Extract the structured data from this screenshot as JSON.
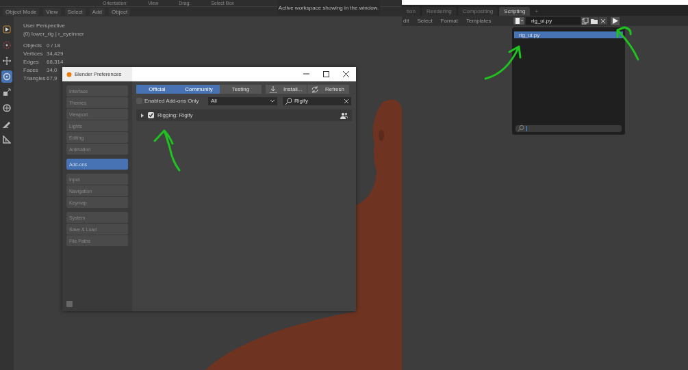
{
  "viewport_header": {
    "items": [
      "Orientation:",
      "View",
      "Drag:",
      "Select Box"
    ]
  },
  "viewport_menu": {
    "mode": "Object Mode",
    "items": [
      "View",
      "Select",
      "Add",
      "Object"
    ]
  },
  "toolbar": {
    "tools": [
      {
        "kind": "select",
        "selected": false
      },
      {
        "kind": "cursor",
        "selected": false
      },
      {
        "kind": "move",
        "selected": false
      },
      {
        "kind": "rotate",
        "selected": true
      },
      {
        "kind": "scale",
        "selected": false
      },
      {
        "kind": "transform",
        "selected": false
      },
      {
        "kind": "annotate",
        "selected": false
      },
      {
        "kind": "measure",
        "selected": false
      }
    ]
  },
  "viewport_info": {
    "view": "User Perspective",
    "object": "(0) lower_rig | r_eyeinner",
    "stats": [
      {
        "label": "Objects",
        "value": "0 / 18"
      },
      {
        "label": "Vertices",
        "value": "34,429"
      },
      {
        "label": "Edges",
        "value": "68,314"
      },
      {
        "label": "Faces",
        "value": "34,0"
      },
      {
        "label": "Triangles",
        "value": "67,9"
      }
    ]
  },
  "tooltip": "Active workspace showing in the window.",
  "preferences": {
    "title": "Blender Preferences",
    "sidebar": {
      "groups": [
        {
          "items": [
            {
              "label": "Interface",
              "selected": false
            },
            {
              "label": "Themes",
              "selected": false
            },
            {
              "label": "Viewport",
              "selected": false
            },
            {
              "label": "Lights",
              "selected": false
            },
            {
              "label": "Editing",
              "selected": false
            },
            {
              "label": "Animation",
              "selected": false
            }
          ]
        },
        {
          "items": [
            {
              "label": "Add-ons",
              "selected": true
            }
          ]
        },
        {
          "items": [
            {
              "label": "Input",
              "selected": false
            },
            {
              "label": "Navigation",
              "selected": false
            },
            {
              "label": "Keymap",
              "selected": false
            }
          ]
        },
        {
          "items": [
            {
              "label": "System",
              "selected": false
            },
            {
              "label": "Save & Load",
              "selected": false
            },
            {
              "label": "File Paths",
              "selected": false
            }
          ]
        }
      ]
    },
    "filter_tabs": [
      {
        "label": "Official",
        "selected": true
      },
      {
        "label": "Community",
        "selected": true
      },
      {
        "label": "Testing",
        "selected": false
      }
    ],
    "buttons": [
      {
        "label": "Install...",
        "kind": "install"
      },
      {
        "label": "Refresh",
        "kind": "refresh"
      }
    ],
    "enabled_only": {
      "label": "Enabled Add-ons Only",
      "checked": false
    },
    "category": {
      "value": "All"
    },
    "search": {
      "value": "Rigify"
    },
    "addons": [
      {
        "name": "Rigging: Rigify",
        "expanded": false,
        "checked": true
      }
    ]
  },
  "scripting": {
    "tabs": [
      {
        "label": "tion",
        "selected": false
      },
      {
        "label": "Rendering",
        "selected": false
      },
      {
        "label": "Compositing",
        "selected": false
      },
      {
        "label": "Scripting",
        "selected": true
      }
    ],
    "add_tab": "+",
    "menu": [
      "dit",
      "Select",
      "Format",
      "Templates"
    ],
    "text_name": "rig_ui.py",
    "dropdown": {
      "items": [
        {
          "label": "rig_ui.py",
          "selected": true
        }
      ]
    }
  }
}
